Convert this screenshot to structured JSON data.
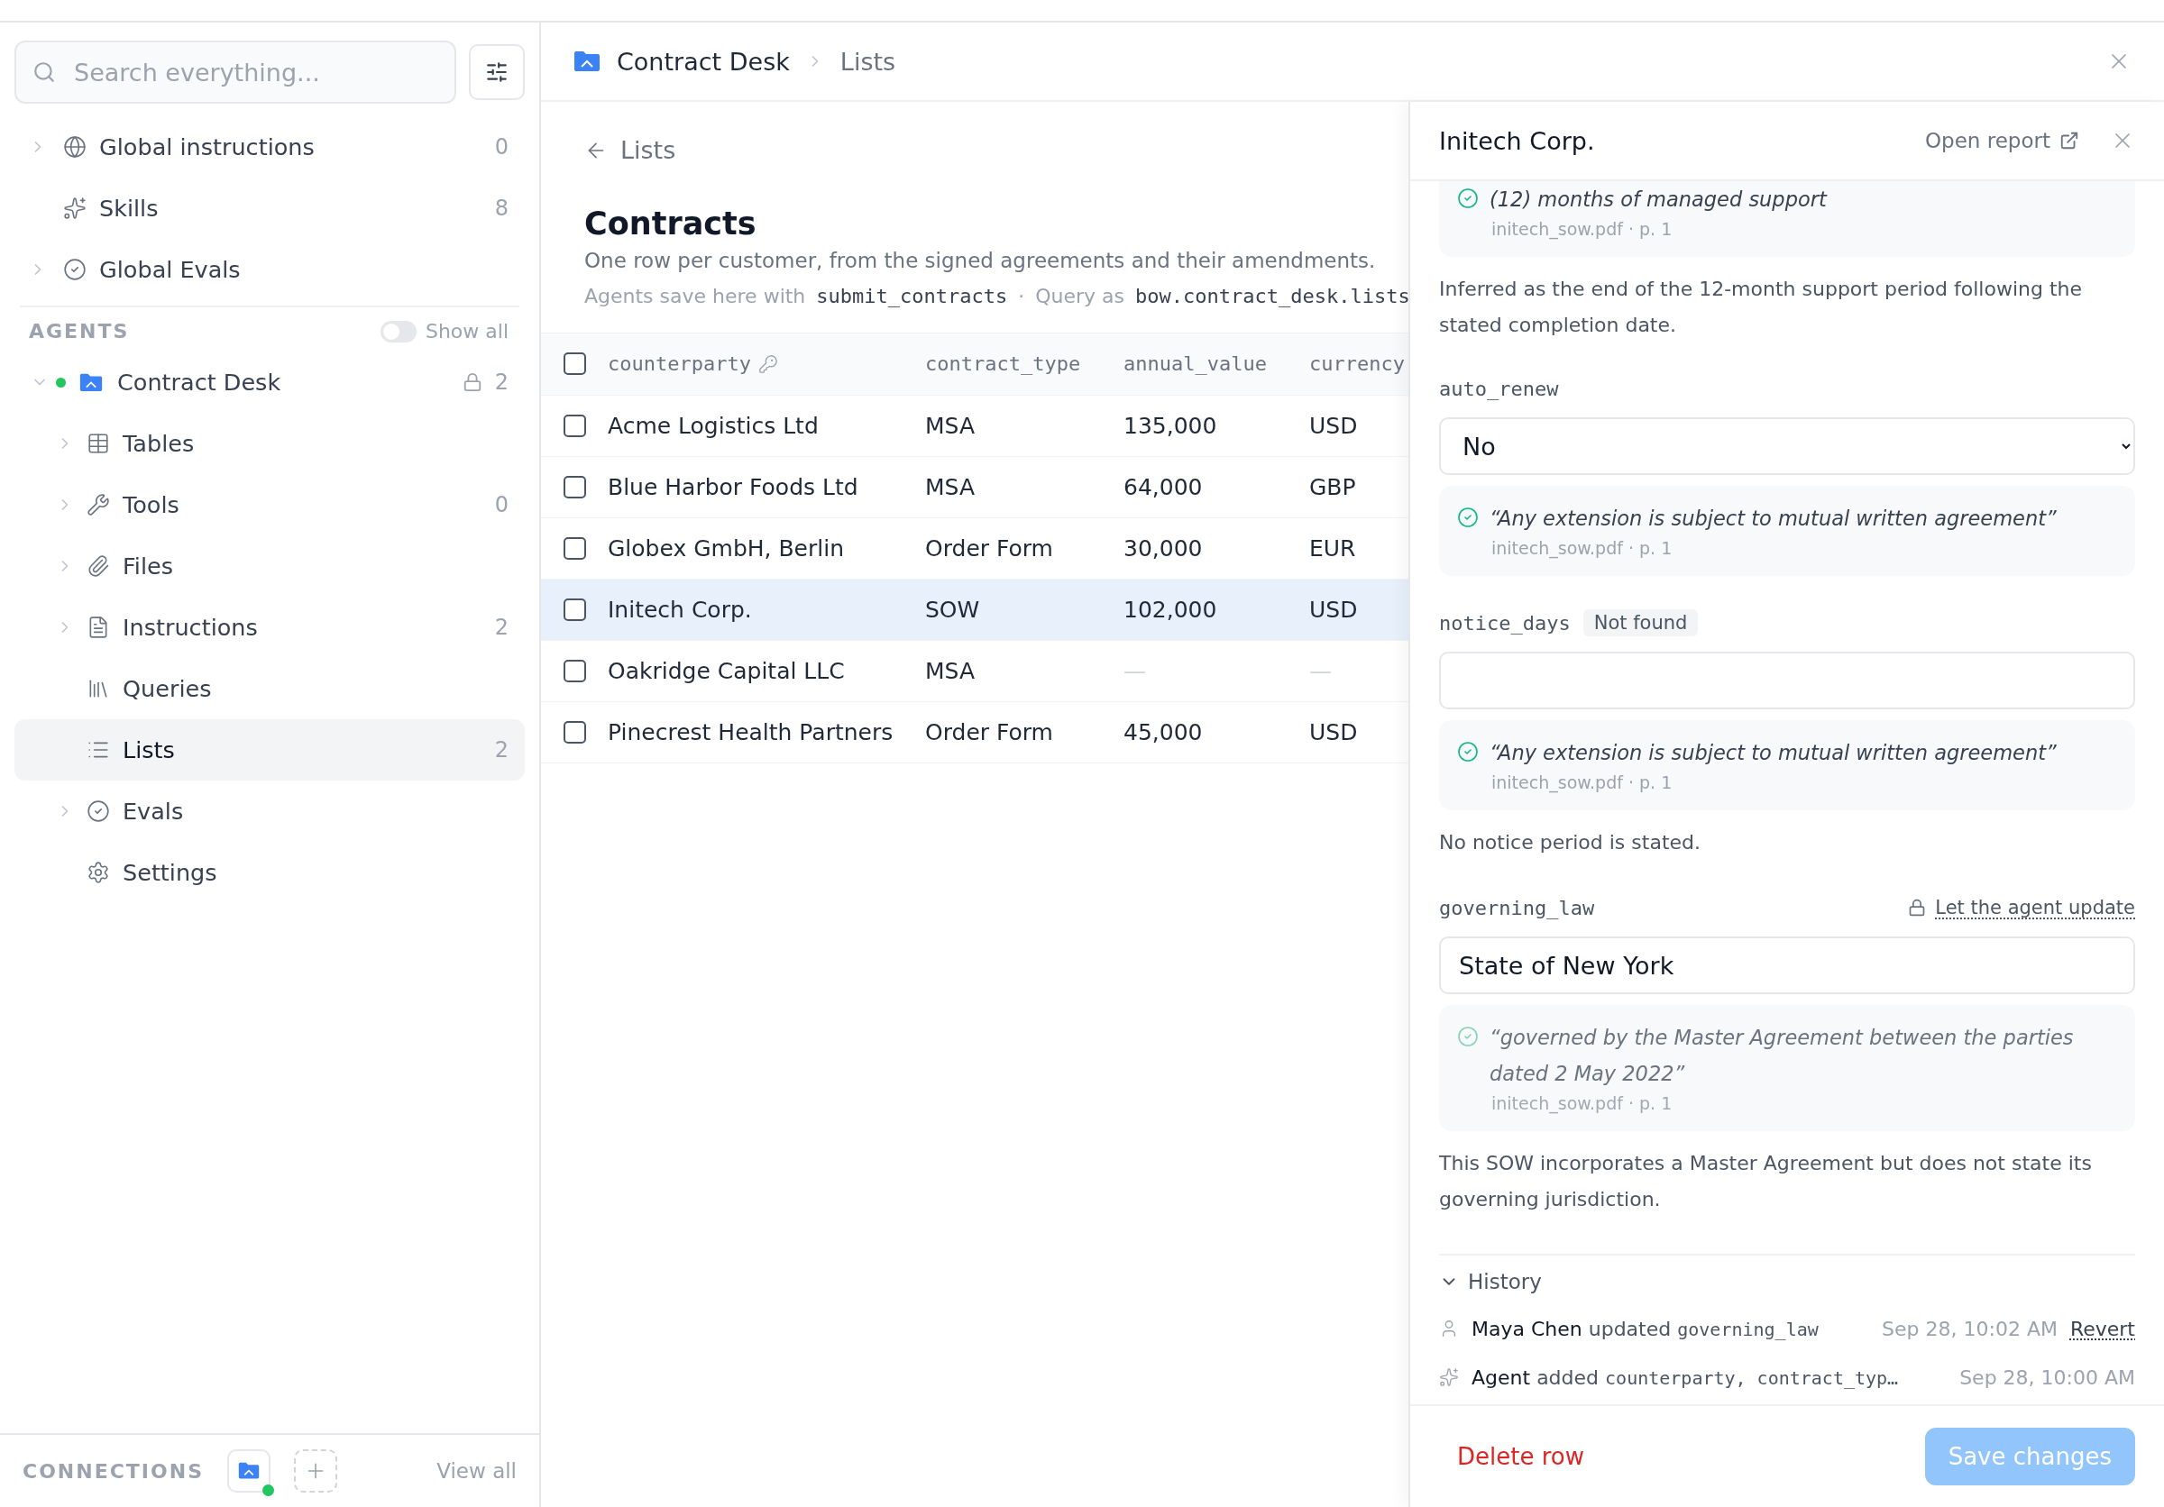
{
  "sidebar": {
    "search": {
      "placeholder": "Search everything..."
    },
    "global_items": [
      {
        "label": "Global instructions",
        "count": "0",
        "expandable": true
      },
      {
        "label": "Skills",
        "count": "8",
        "expandable": false
      },
      {
        "label": "Global Evals",
        "expandable": true
      }
    ],
    "agents": {
      "title": "AGENTS",
      "show_all": {
        "label": "Show all",
        "on": false
      }
    },
    "agent": {
      "name": "Contract Desk",
      "color": "#22c55e",
      "expanded": true,
      "locked": true,
      "count": "2",
      "children": [
        {
          "label": "Tables",
          "expandable": true,
          "selected": false
        },
        {
          "label": "Tools",
          "count": "0",
          "expandable": true,
          "selected": false
        },
        {
          "label": "Files",
          "expandable": true,
          "selected": false
        },
        {
          "label": "Instructions",
          "count": "2",
          "expandable": true,
          "selected": false
        },
        {
          "label": "Queries",
          "expandable": false,
          "selected": false
        },
        {
          "label": "Lists",
          "count": "2",
          "expandable": false,
          "selected": true
        },
        {
          "label": "Evals",
          "expandable": true,
          "selected": false
        },
        {
          "label": "Settings",
          "expandable": false,
          "selected": false
        }
      ]
    },
    "connections": {
      "title": "CONNECTIONS",
      "online": true,
      "view_all": "View all"
    }
  },
  "breadcrumb": [
    "Contract Desk",
    "Lists"
  ],
  "list": {
    "back": "Lists",
    "title": "Contracts",
    "description": "One row per customer, from the signed agreements and their amendments.",
    "usage": {
      "save_label": "Agents save here with",
      "save_tool": "submit_contracts",
      "separator": "·",
      "query_label": "Query as",
      "query_name": "bow.contract_desk.lists"
    },
    "table": {
      "all_checked": false,
      "columns": [
        {
          "name": "counterparty",
          "key": true
        },
        {
          "name": "contract_type"
        },
        {
          "name": "annual_value"
        },
        {
          "name": "currency"
        }
      ],
      "rows": [
        {
          "selected": false,
          "checked": false,
          "cells": [
            "Acme Logistics Ltd",
            "MSA",
            "135,000",
            "USD"
          ]
        },
        {
          "selected": false,
          "checked": false,
          "cells": [
            "Blue Harbor Foods Ltd",
            "MSA",
            "64,000",
            "GBP"
          ]
        },
        {
          "selected": false,
          "checked": false,
          "cells": [
            "Globex GmbH, Berlin",
            "Order Form",
            "30,000",
            "EUR"
          ]
        },
        {
          "selected": true,
          "checked": false,
          "cells": [
            "Initech Corp.",
            "SOW",
            "102,000",
            "USD"
          ]
        },
        {
          "selected": false,
          "checked": false,
          "cells": [
            "Oakridge Capital LLC",
            "MSA",
            "—",
            "—"
          ]
        },
        {
          "selected": false,
          "checked": false,
          "cells": [
            "Pinecrest Health Partners",
            "Order Form",
            "45,000",
            "USD"
          ]
        }
      ]
    }
  },
  "detail": {
    "title": "Initech Corp.",
    "open_report": "Open report",
    "top_citation": {
      "quote": "(12) months of managed support",
      "source": "initech_sow.pdf · p. 1",
      "dimmed": false
    },
    "top_note": "Inferred as the end of the 12-month support period following the stated completion date.",
    "fields": [
      {
        "kind": "select",
        "label": "auto_renew",
        "value": "No",
        "citation": {
          "quote": "“Any extension is subject to mutual written agreement”",
          "source": "initech_sow.pdf · p. 1",
          "dimmed": false
        }
      },
      {
        "kind": "input",
        "label": "notice_days",
        "badge": "Not found",
        "citation": {
          "quote": "“Any extension is subject to mutual written agreement”",
          "source": "initech_sow.pdf · p. 1",
          "dimmed": false
        },
        "note": "No notice period is stated."
      },
      {
        "kind": "input",
        "label": "governing_law",
        "locked": true,
        "lock_action": "Let the agent update",
        "value": "State of New York",
        "citation": {
          "quote": "“governed by the Master Agreement between the parties dated 2 May 2022”",
          "source": "initech_sow.pdf · p. 1",
          "dimmed": true
        },
        "note": "This SOW incorporates a Master Agreement but does not state its governing jurisdiction."
      }
    ],
    "history": {
      "title": "History",
      "expanded": true,
      "entries": [
        {
          "kind": "user",
          "actor": "Maya Chen",
          "action": "updated",
          "fields": "governing_law",
          "time": "Sep 28, 10:02 AM",
          "revert": "Revert"
        },
        {
          "kind": "agent",
          "actor": "Agent",
          "action": "added",
          "fields": "counterparty, contract_typ…",
          "time": "Sep 28, 10:00 AM"
        }
      ]
    },
    "delete": "Delete row",
    "save": {
      "label": "Save changes",
      "disabled": true
    }
  }
}
